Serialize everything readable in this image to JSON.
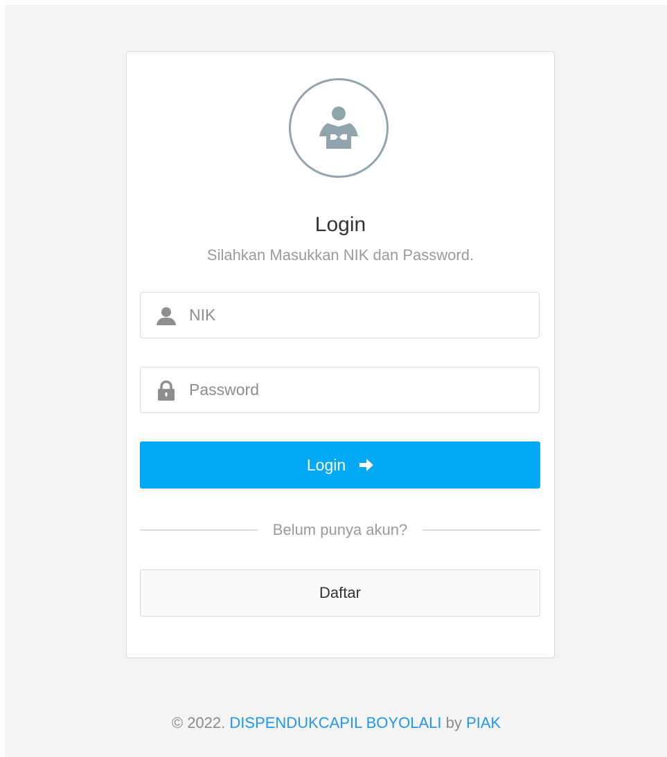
{
  "logo": {
    "icon": "reader-icon",
    "color": "#90a4ae"
  },
  "login": {
    "title": "Login",
    "subtitle": "Silahkan Masukkan NIK dan Password.",
    "nik_placeholder": "NIK",
    "password_placeholder": "Password",
    "submit_label": "Login",
    "submit_color": "#03a9f4",
    "register_prompt": "Belum punya akun?",
    "register_label": "Daftar"
  },
  "footer": {
    "copyright": "© 2022.",
    "org_link": "DISPENDUKCAPIL BOYOLALI",
    "by": "by",
    "author_link": "PIAK",
    "link_color": "#2196f3"
  }
}
